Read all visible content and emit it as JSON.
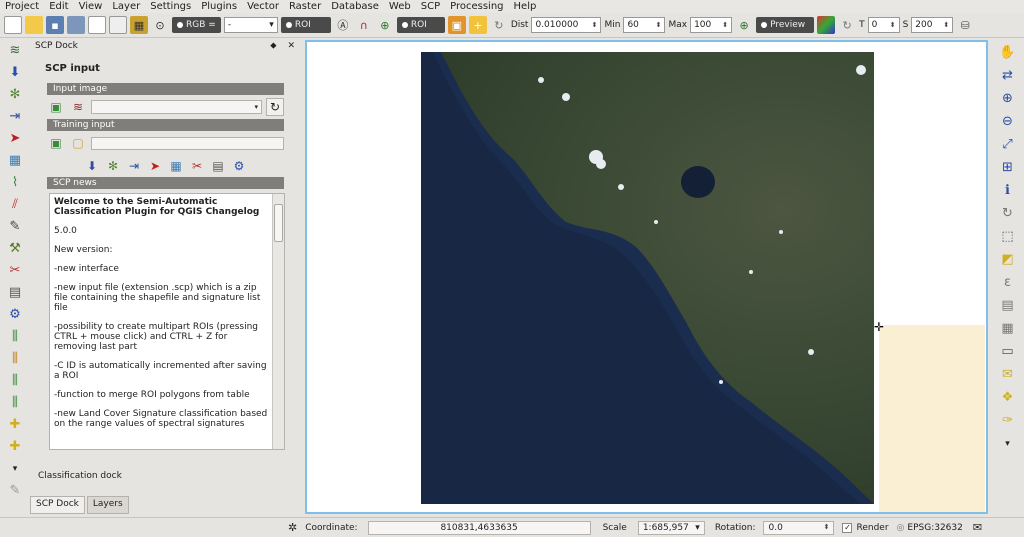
{
  "menu": [
    "Project",
    "Edit",
    "View",
    "Layer",
    "Settings",
    "Plugins",
    "Vector",
    "Raster",
    "Database",
    "Web",
    "SCP",
    "Processing",
    "Help"
  ],
  "toolbar": {
    "rgb_label": "RGB =",
    "rgb_value": "-",
    "roi_label": "ROI",
    "dist_label": "Dist",
    "dist_value": "0.010000",
    "min_label": "Min",
    "min_value": "60",
    "max_label": "Max",
    "max_value": "100",
    "preview_label": "Preview",
    "t_label": "T",
    "t_value": "0",
    "s_label": "S",
    "s_value": "200"
  },
  "dock": {
    "title": "SCP Dock",
    "input_title": "SCP input",
    "input_image_label": "Input image",
    "training_input_label": "Training input",
    "news_label": "SCP news",
    "news_heading": "Welcome to the Semi-Automatic Classification Plugin for QGIS Changelog",
    "news_items": [
      "5.0.0",
      "New version:",
      "-new interface",
      "-new input file (extension .scp) which is a zip file containing the shapefile and signature list file",
      "-possibility to create multipart ROIs (pressing CTRL + mouse click) and CTRL + Z for removing last part",
      "-C ID is automatically incremented after saving a ROI",
      "-function to merge ROI polygons from table",
      "-new Land Cover Signature classification based on the range values of spectral signatures"
    ],
    "classification_dock": "Classification dock",
    "tabs": [
      "SCP Dock",
      "Layers"
    ]
  },
  "status": {
    "coordinate_label": "Coordinate:",
    "coordinate_value": "810831,4633635",
    "scale_label": "Scale",
    "scale_value": "1:685,957",
    "rotation_label": "Rotation:",
    "rotation_value": "0.0",
    "render_label": "Render",
    "crs_label": "EPSG:32632"
  },
  "colors": {
    "map_border": "#7fbfe8",
    "section_bar": "#807e7b",
    "sea": "#1b2d4f",
    "land": "#3b4a35",
    "beige_panel": "#faeed3"
  }
}
